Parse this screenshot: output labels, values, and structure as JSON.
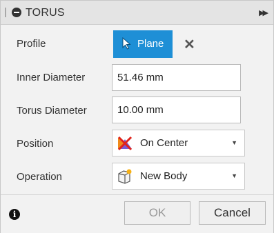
{
  "dialog": {
    "title": "TORUS",
    "rows": {
      "profile": {
        "label": "Profile",
        "selection_label": "Plane"
      },
      "inner_diameter": {
        "label": "Inner Diameter",
        "value": "51.46 mm"
      },
      "torus_diameter": {
        "label": "Torus Diameter",
        "value": "10.00 mm"
      },
      "position": {
        "label": "Position",
        "value": "On Center"
      },
      "operation": {
        "label": "Operation",
        "value": "New Body"
      }
    },
    "buttons": {
      "ok": "OK",
      "cancel": "Cancel"
    }
  },
  "colors": {
    "selection_blue": "#1e8fd6",
    "titlebar": "#e4e4e4",
    "panel": "#f2f2f2"
  },
  "icons": [
    "torus-icon",
    "expand-icon",
    "cursor-icon",
    "clear-icon",
    "on-center-icon",
    "new-body-icon",
    "info-icon"
  ]
}
